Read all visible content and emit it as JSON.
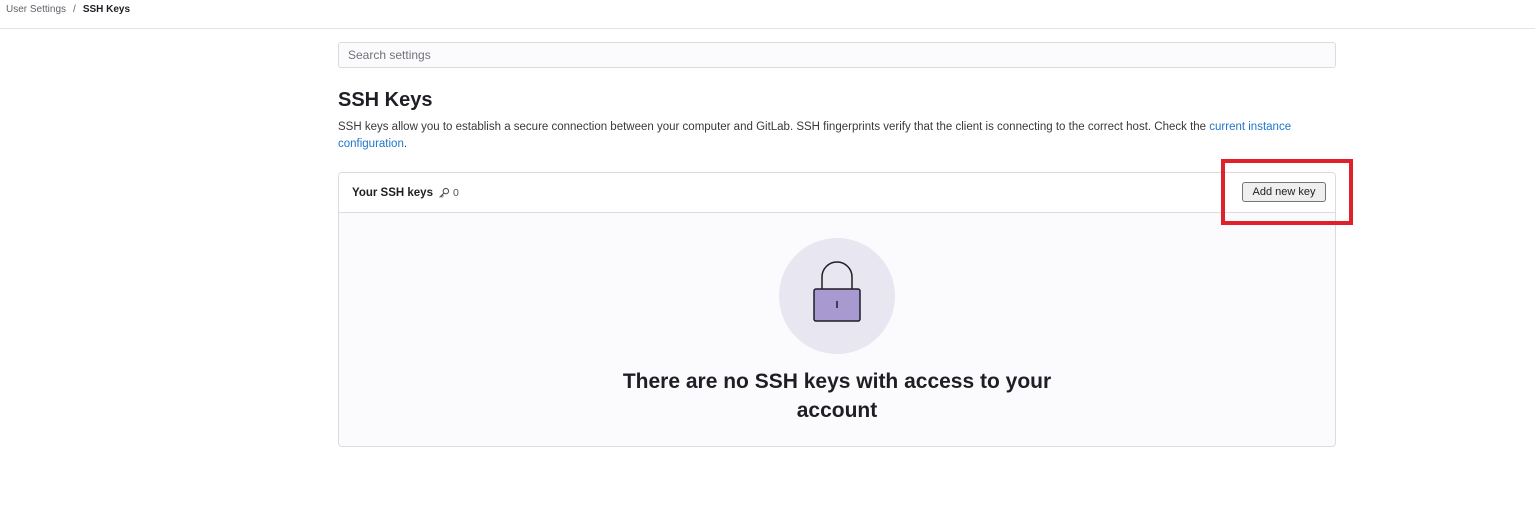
{
  "breadcrumb": {
    "parent": "User Settings",
    "separator": "/",
    "current": "SSH Keys"
  },
  "search": {
    "placeholder": "Search settings",
    "value": ""
  },
  "page": {
    "title": "SSH Keys",
    "description": "SSH keys allow you to establish a secure connection between your computer and GitLab. SSH fingerprints verify that the client is connecting to the correct host. Check the ",
    "description_link": "current instance configuration",
    "description_end": "."
  },
  "keys_card": {
    "title": "Your SSH keys",
    "count": "0",
    "count_icon": "key-icon",
    "add_button_label": "Add new key"
  },
  "empty_state": {
    "illustration": "padlock-icon",
    "title": "There are no SSH keys with access to your account"
  },
  "colors": {
    "link": "#1f75cb",
    "highlight": "#e0202a",
    "lock_body": "#a89ad0",
    "illustration_bg": "#e8e6f1"
  }
}
